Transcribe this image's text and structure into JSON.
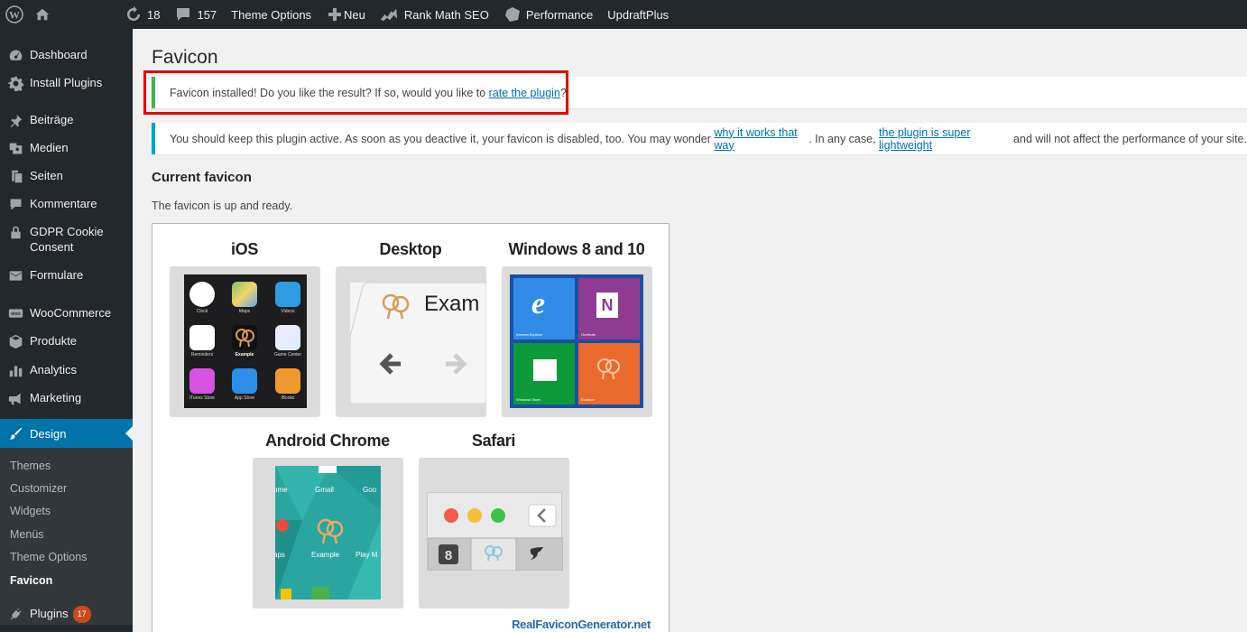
{
  "adminbar": {
    "updates_count": "18",
    "comments_count": "157",
    "theme_options": "Theme Options",
    "new_label": "Neu",
    "rank_math": "Rank Math SEO",
    "performance": "Performance",
    "updraft": "UpdraftPlus"
  },
  "sidebar": {
    "items": [
      {
        "label": "Dashboard",
        "icon": "dashboard-icon"
      },
      {
        "label": "Install Plugins",
        "icon": "gear-icon"
      },
      {
        "label": "Beiträge",
        "icon": "pin-icon"
      },
      {
        "label": "Medien",
        "icon": "media-icon"
      },
      {
        "label": "Seiten",
        "icon": "pages-icon"
      },
      {
        "label": "Kommentare",
        "icon": "comment-icon"
      },
      {
        "label": "GDPR Cookie Consent",
        "icon": "lock-icon"
      },
      {
        "label": "Formulare",
        "icon": "mail-icon"
      },
      {
        "label": "WooCommerce",
        "icon": "woo-icon"
      },
      {
        "label": "Produkte",
        "icon": "box-icon"
      },
      {
        "label": "Analytics",
        "icon": "bar-chart-icon"
      },
      {
        "label": "Marketing",
        "icon": "megaphone-icon"
      },
      {
        "label": "Design",
        "icon": "brush-icon"
      },
      {
        "label": "Plugins",
        "icon": "plug-icon"
      }
    ],
    "submenu": [
      "Themes",
      "Customizer",
      "Widgets",
      "Menüs",
      "Theme Options",
      "Favicon"
    ],
    "plugins_badge": "17"
  },
  "main": {
    "page_title": "Favicon",
    "success_notice": {
      "text_before": "Favicon installed! Do you like the result? If so, would you like to ",
      "link": "rate the plugin",
      "text_after": "?"
    },
    "info_notice": {
      "text1": "You should keep this plugin active. As soon as you deactive it, your favicon is disabled, too. You may wonder ",
      "link1": "why it works that way",
      "text2": ". In any case, ",
      "link2": "the plugin is super lightweight",
      "text3": " and will not affect the performance of your site."
    },
    "section_title": "Current favicon",
    "section_text": "The favicon is up and ready."
  },
  "preview": {
    "platforms": [
      "iOS",
      "Desktop",
      "Windows 8 and 10",
      "Android Chrome",
      "Safari"
    ],
    "ios_apps": [
      "Clock",
      "Maps",
      "Videos",
      "Reminders",
      "Example",
      "Game Center",
      "iTunes Store",
      "App Store",
      "iBooks"
    ],
    "desktop_tab": "Exam",
    "windows_tiles": [
      "Internet Explorer",
      "OneNote",
      "Windows Store",
      "Example"
    ],
    "android_labels": [
      "Gmail",
      "Example",
      "Play M",
      "ome",
      "Goo",
      "aps"
    ],
    "brand": "RealFaviconGenerator.net"
  },
  "colors": {
    "admin_bg": "#23282d",
    "accent": "#0073aa",
    "success": "#46b450",
    "info": "#00a0d2",
    "highlight": "#e50000"
  }
}
